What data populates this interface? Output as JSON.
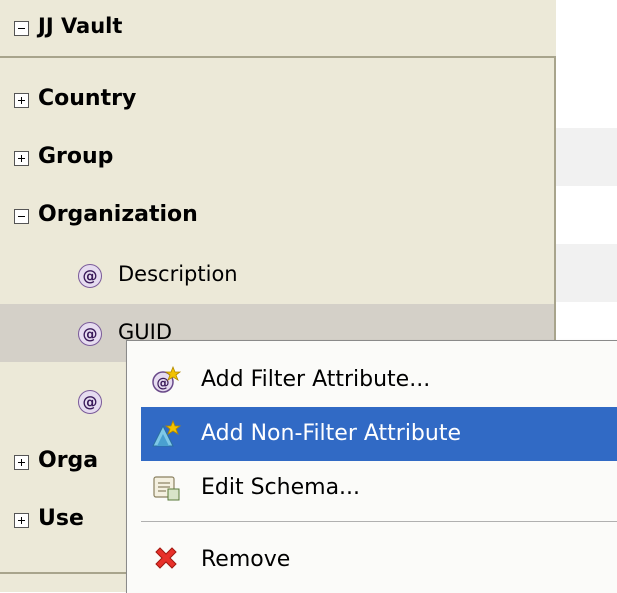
{
  "tree": {
    "root": {
      "label": "JJ Vault",
      "state": "expanded"
    },
    "items": [
      {
        "label": "Country",
        "state": "collapsed"
      },
      {
        "label": "Group",
        "state": "collapsed"
      },
      {
        "label": "Organization",
        "state": "expanded"
      }
    ],
    "attributes": [
      {
        "label": "Description",
        "icon": "at-sign-attribute-icon"
      },
      {
        "label": "GUID",
        "icon": "at-sign-attribute-icon"
      },
      {
        "label": "",
        "icon": "at-sign-attribute-icon"
      }
    ],
    "more_items": [
      {
        "label": "Orga",
        "state": "collapsed"
      },
      {
        "label": "Use",
        "state": "collapsed"
      }
    ]
  },
  "context_menu": {
    "items": [
      {
        "label": "Add Filter Attribute...",
        "icon": "add-filter-attribute-icon"
      },
      {
        "label": "Add Non-Filter Attribute",
        "icon": "add-non-filter-attribute-icon",
        "highlighted": true
      },
      {
        "label": "Edit Schema...",
        "icon": "edit-schema-icon"
      },
      {
        "label": "Remove",
        "icon": "remove-icon"
      }
    ]
  },
  "colors": {
    "highlight": "#316ac5",
    "panel": "#ece9d8",
    "remove": "#e8302a"
  }
}
